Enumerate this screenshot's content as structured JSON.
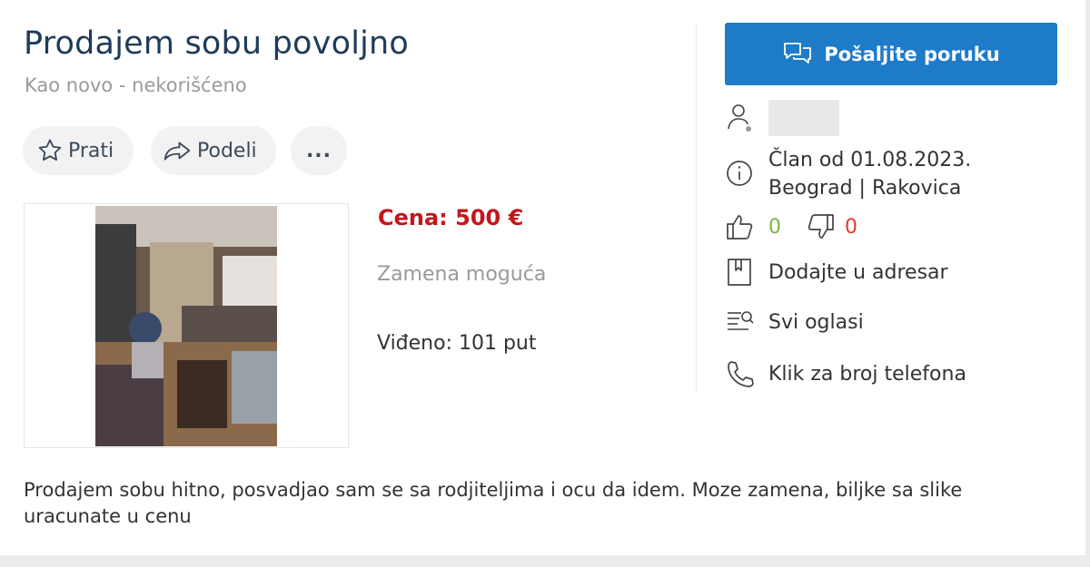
{
  "listing": {
    "title": "Prodajem sobu povoljno",
    "condition": "Kao novo - nekorišćeno",
    "price": "Cena: 500 €",
    "exchange": "Zamena moguća",
    "views": "Viđeno: 101 put",
    "description": "Prodajem sobu hitno, posvadjao sam se sa rodjiteljima i ocu da idem. Moze zamena, biljke sa slike uracunate u cenu"
  },
  "actions": {
    "follow_label": "Prati",
    "share_label": "Podeli",
    "more_label": "..."
  },
  "seller": {
    "send_message_label": "Pošaljite poruku",
    "member_since": "Član od 01.08.2023.",
    "location": "Beograd | Rakovica",
    "likes": "0",
    "dislikes": "0",
    "add_to_addressbook_label": "Dodajte u adresar",
    "all_ads_label": "Svi oglasi",
    "phone_label": "Klik za broj telefona"
  },
  "colors": {
    "accent": "#1e7bc8",
    "price": "#c4161c",
    "title": "#1f3b5a",
    "like": "#7cb342",
    "dislike": "#e53935"
  },
  "icons": [
    "star-icon",
    "share-icon",
    "chat-icon",
    "user-icon",
    "info-icon",
    "thumbs-up-icon",
    "thumbs-down-icon",
    "bookmark-icon",
    "list-icon",
    "phone-icon"
  ]
}
